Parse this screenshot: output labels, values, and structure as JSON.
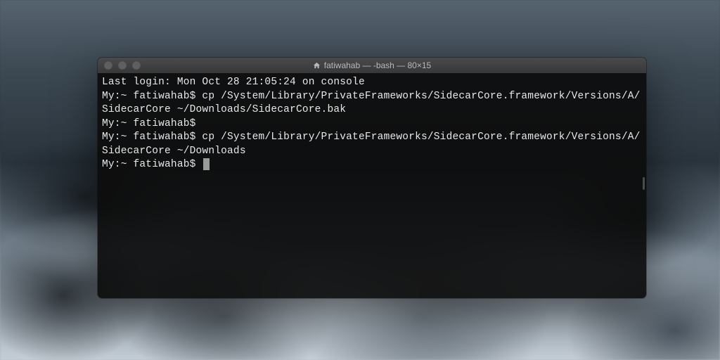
{
  "window": {
    "title": "fatiwahab — -bash — 80×15"
  },
  "terminal": {
    "lines": [
      "Last login: Mon Oct 28 21:05:24 on console",
      "My:~ fatiwahab$ cp /System/Library/PrivateFrameworks/SidecarCore.framework/Versions/A/SidecarCore ~/Downloads/SidecarCore.bak",
      "My:~ fatiwahab$",
      "My:~ fatiwahab$ cp /System/Library/PrivateFrameworks/SidecarCore.framework/Versions/A/SidecarCore ~/Downloads",
      "My:~ fatiwahab$ "
    ]
  }
}
